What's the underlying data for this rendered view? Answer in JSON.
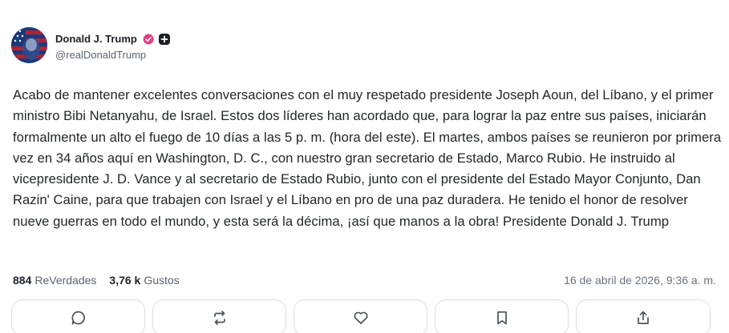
{
  "author": {
    "display_name": "Donald J. Trump",
    "handle": "@realDonaldTrump",
    "verified": true,
    "badge_color": "#e0407f"
  },
  "post": {
    "text": "Acabo de mantener excelentes conversaciones con el muy respetado presidente Joseph Aoun, del Líbano, y el primer ministro Bibi Netanyahu, de Israel. Estos dos líderes han acordado que, para lograr la paz entre sus países, iniciarán formalmente un alto el fuego de 10 días a las 5 p. m. (hora del este). El martes, ambos países se reunieron por primera vez en 34 años aquí en Washington, D. C., con nuestro gran secretario de Estado, Marco Rubio. He instruido al vicepresidente J. D. Vance y al secretario de Estado Rubio, junto con el presidente del Estado Mayor Conjunto, Dan Razin' Caine, para que trabajen con Israel y el Líbano en pro de una paz duradera. He tenido el honor de resolver nueve guerras en todo el mundo, y esta será la décima, ¡así que manos a la obra! Presidente Donald J. Trump"
  },
  "stats": {
    "retruths_count": "884",
    "retruths_label": "ReVerdades",
    "likes_count": "3,76 k",
    "likes_label": "Gustos",
    "timestamp": "16 de abril de 2026, 9:36 a. m."
  },
  "actions": [
    {
      "icon": "reply-icon"
    },
    {
      "icon": "retruth-icon"
    },
    {
      "icon": "heart-icon"
    },
    {
      "icon": "bookmark-icon"
    },
    {
      "icon": "share-icon"
    }
  ]
}
